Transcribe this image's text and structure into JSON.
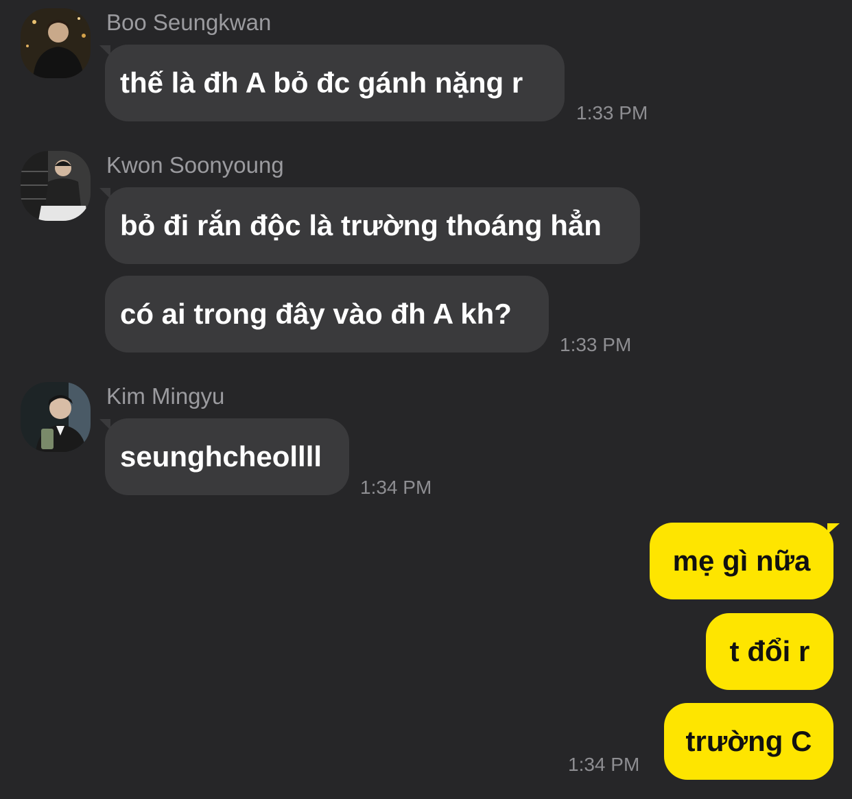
{
  "messages": [
    {
      "sender": "Boo Seungkwan",
      "avatar_icon": "profile-photo-icon",
      "bubbles": [
        "thế là đh A bỏ đc gánh nặng r"
      ],
      "time": "1:33 PM"
    },
    {
      "sender": "Kwon Soonyoung",
      "avatar_icon": "profile-photo-icon",
      "bubbles": [
        "bỏ đi rắn độc là trường thoáng hẳn",
        "có ai trong đây vào đh A kh?"
      ],
      "time": "1:33 PM"
    },
    {
      "sender": "Kim Mingyu",
      "avatar_icon": "profile-photo-icon",
      "bubbles": [
        "seunghcheollll"
      ],
      "time": "1:34 PM"
    },
    {
      "sender": "me",
      "bubbles": [
        "mẹ gì nữa",
        "t đổi r",
        "trường C"
      ],
      "time": "1:34 PM"
    }
  ],
  "colors": {
    "background": "#262628",
    "incoming_bubble": "#3a3a3c",
    "outgoing_bubble": "#fee500",
    "sender_name": "#9b9b9f",
    "timestamp": "#8e8e92"
  }
}
